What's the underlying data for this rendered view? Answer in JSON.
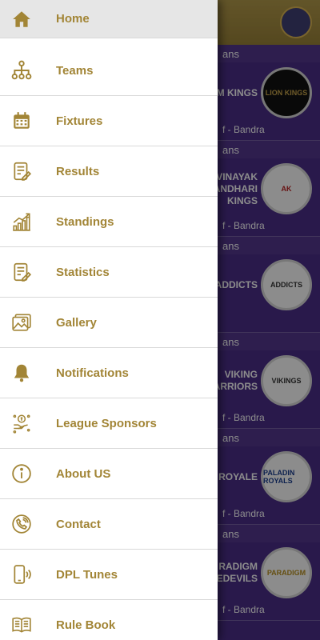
{
  "colors": {
    "accent_gold": "#a28536",
    "drawer_bg": "#ffffff",
    "active_bg": "#e6e6e6",
    "background_purple": "#4a2d88"
  },
  "drawer": {
    "items": [
      {
        "label": "Home",
        "icon": "home-icon",
        "active": true
      },
      {
        "label": "Teams",
        "icon": "org-chart-icon"
      },
      {
        "label": "Fixtures",
        "icon": "calendar-icon"
      },
      {
        "label": "Results",
        "icon": "document-edit-icon"
      },
      {
        "label": "Standings",
        "icon": "chart-up-icon"
      },
      {
        "label": "Statistics",
        "icon": "document-edit-icon"
      },
      {
        "label": "Gallery",
        "icon": "image-icon"
      },
      {
        "label": "Notifications",
        "icon": "bell-icon"
      },
      {
        "label": "League Sponsors",
        "icon": "sponsor-icon"
      },
      {
        "label": "About US",
        "icon": "info-icon"
      },
      {
        "label": "Contact",
        "icon": "phone-icon"
      },
      {
        "label": "DPL Tunes",
        "icon": "mobile-sound-icon"
      },
      {
        "label": "Rule Book",
        "icon": "book-icon"
      }
    ]
  },
  "background": {
    "teams": [
      {
        "header": "ans",
        "name": "M KINGS",
        "venue": "f - Bandra",
        "logo_text": "LION KINGS"
      },
      {
        "header": "ans",
        "name": "VINAYAK\nANDHARI\nKINGS",
        "venue": "f - Bandra",
        "logo_text": "AK"
      },
      {
        "header": "ans",
        "name": "ADDICTS",
        "venue": "",
        "logo_text": "ADDICTS"
      },
      {
        "header": "ans",
        "name": "VIKING\nARRIORS",
        "venue": "f - Bandra",
        "logo_text": "VIKINGS"
      },
      {
        "header": "ans",
        "name": "ROYALE",
        "venue": "f - Bandra",
        "logo_text": "PALADIN ROYALS"
      },
      {
        "header": "ans",
        "name": "RADIGM\nEDEVILS",
        "venue": "f - Bandra",
        "logo_text": "PARADIGM"
      }
    ]
  }
}
